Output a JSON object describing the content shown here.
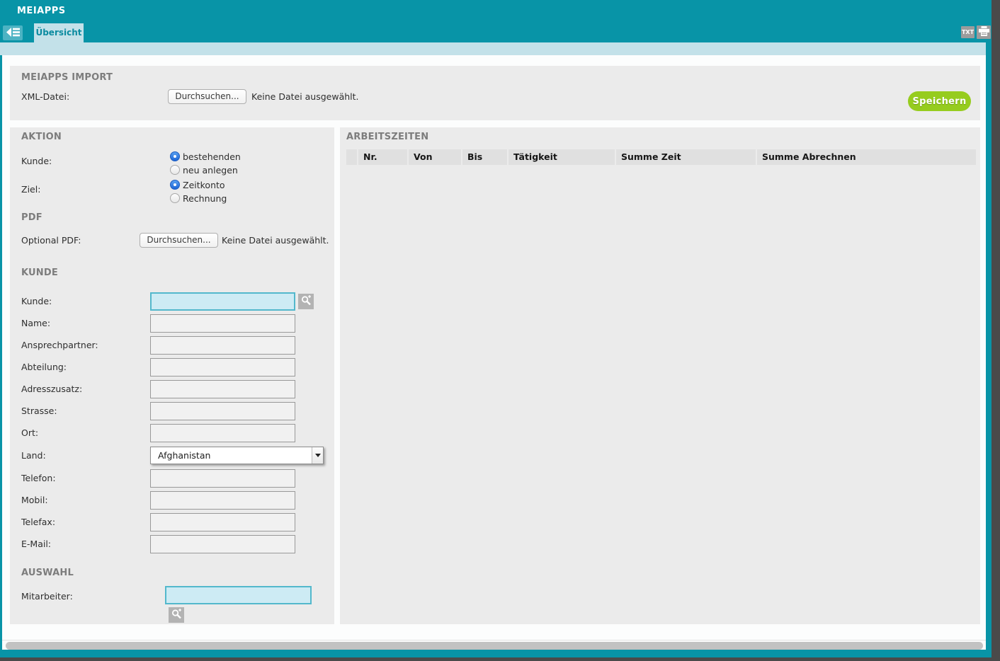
{
  "colors": {
    "teal": "#0894a7",
    "teal_light": "#4cb3c3",
    "tab_blue": "#c3e1e9",
    "panel_gray": "#ebebeb",
    "table_header_gray": "#e0e0e0",
    "save_green": "#96cc1e",
    "highlight_input_bg": "#cdebf4",
    "highlight_input_border": "#53b8cc",
    "icon_gray": "#9c9c9c"
  },
  "header": {
    "app_title": "MEIAPPS"
  },
  "tabs": {
    "active_label": "Übersicht"
  },
  "toolbar": {
    "txt_label": "TXT"
  },
  "import_section": {
    "title": "MEIAPPS IMPORT",
    "xml_label": "XML-Datei:",
    "browse_label": "Durchsuchen...",
    "no_file_text": "Keine Datei ausgewählt.",
    "save_label": "Speichern"
  },
  "aktion": {
    "title": "AKTION",
    "kunde_label": "Kunde:",
    "kunde_options": [
      {
        "label": "bestehenden",
        "selected": true
      },
      {
        "label": "neu anlegen",
        "selected": false
      }
    ],
    "ziel_label": "Ziel:",
    "ziel_options": [
      {
        "label": "Zeitkonto",
        "selected": true
      },
      {
        "label": "Rechnung",
        "selected": false
      }
    ]
  },
  "pdf_section": {
    "title": "PDF",
    "label": "Optional PDF:",
    "browse_label": "Durchsuchen...",
    "no_file_text": "Keine Datei ausgewählt."
  },
  "kunde_section": {
    "title": "KUNDE",
    "fields": [
      {
        "label": "Kunde:",
        "value": ""
      },
      {
        "label": "Name:",
        "value": ""
      },
      {
        "label": "Ansprechpartner:",
        "value": ""
      },
      {
        "label": "Abteilung:",
        "value": ""
      },
      {
        "label": "Adresszusatz:",
        "value": ""
      },
      {
        "label": "Strasse:",
        "value": ""
      },
      {
        "label": "Ort:",
        "value": ""
      },
      {
        "label": "Land:",
        "value": "Afghanistan"
      },
      {
        "label": "Telefon:",
        "value": ""
      },
      {
        "label": "Mobil:",
        "value": ""
      },
      {
        "label": "Telefax:",
        "value": ""
      },
      {
        "label": "E-Mail:",
        "value": ""
      }
    ]
  },
  "auswahl_section": {
    "title": "AUSWAHL",
    "mitarbeiter_label": "Mitarbeiter:",
    "mitarbeiter_value": ""
  },
  "arbeitszeiten": {
    "title": "ARBEITSZEITEN",
    "columns": [
      "",
      "Nr.",
      "Von",
      "Bis",
      "Tätigkeit",
      "Summe Zeit",
      "Summe Abrechnen"
    ],
    "rows": []
  }
}
